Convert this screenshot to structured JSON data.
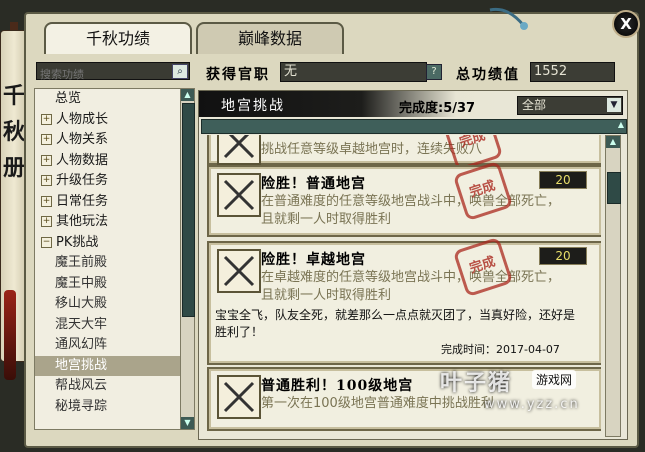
{
  "left_scroll": {
    "chars": [
      "千",
      "秋",
      "册"
    ]
  },
  "tabs": [
    {
      "label": "千秋功绩",
      "active": true
    },
    {
      "label": "巅峰数据",
      "active": false
    }
  ],
  "close_label": "X",
  "search": {
    "placeholder": "搜索功绩"
  },
  "fields": {
    "title_label": "获得官职",
    "title_value": "无",
    "help_label": "?",
    "score_label": "总功绩值",
    "score_value": "1552"
  },
  "sidebar": {
    "items": [
      {
        "label": "总览",
        "expand": ""
      },
      {
        "label": "人物成长",
        "expand": "+"
      },
      {
        "label": "人物关系",
        "expand": "+"
      },
      {
        "label": "人物数据",
        "expand": "+"
      },
      {
        "label": "升级任务",
        "expand": "+"
      },
      {
        "label": "日常任务",
        "expand": "+"
      },
      {
        "label": "其他玩法",
        "expand": "+"
      },
      {
        "label": "PK挑战",
        "expand": "−"
      },
      {
        "label": "魔王前殿",
        "expand": ""
      },
      {
        "label": "魔王中殿",
        "expand": ""
      },
      {
        "label": "移山大殿",
        "expand": ""
      },
      {
        "label": "混天大牢",
        "expand": ""
      },
      {
        "label": "通风幻阵",
        "expand": ""
      },
      {
        "label": "地宫挑战",
        "expand": "",
        "selected": true
      },
      {
        "label": "帮战风云",
        "expand": ""
      },
      {
        "label": "秘境寻踪",
        "expand": ""
      }
    ]
  },
  "header": {
    "title": "地宫挑战",
    "progress": "完成度:5/37",
    "filter": "全部"
  },
  "cards": [
    {
      "title": "",
      "desc": "挑战任意等级卓越地宫时，连续失败八",
      "stamp": "完成",
      "points": ""
    },
    {
      "title": "险胜！普通地宫",
      "desc": "在普通难度的任意等级地宫战斗中，唤兽全部死亡，且就剩一人时取得胜利",
      "stamp": "完成",
      "points": "20"
    },
    {
      "title": "险胜！卓越地宫",
      "desc": "在卓越难度的任意等级地宫战斗中，唤兽全部死亡，且就剩一人时取得胜利",
      "stamp": "完成",
      "points": "20",
      "note": "宝宝全飞，队友全死，就差那么一点点就灭团了，当真好险，还好是胜利了！",
      "date": "完成时间：2017-04-07"
    },
    {
      "title": "普通胜利！100级地宫",
      "desc": "第一次在100级地宫普通难度中挑战胜利",
      "stamp": "",
      "points": ""
    }
  ],
  "watermark": {
    "main": "叶子猪",
    "badge": "游戏网",
    "url": "www.yzz.cn"
  },
  "colors": {
    "panel_bg": "#dcd8bf",
    "dark_bar": "#3f5f5a",
    "stamp_red": "#aa281e",
    "points_text": "#e8de6a"
  }
}
